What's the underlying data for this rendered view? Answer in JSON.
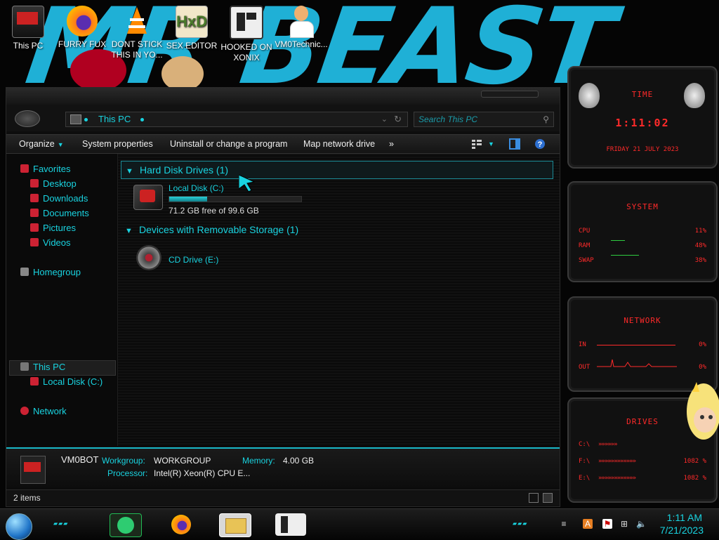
{
  "desktop": {
    "icons": [
      {
        "label": "This PC",
        "icon": "this-pc-icon"
      },
      {
        "label": "FURRY FUX",
        "icon": "firefox-icon"
      },
      {
        "label": "DONT STICK THIS IN YO...",
        "icon": "vlc-icon"
      },
      {
        "label": "SEX EDITOR",
        "icon": "hex-editor-icon"
      },
      {
        "label": "HOOKED ON XONIX",
        "icon": "game-icon"
      },
      {
        "label": "VM0Technic...",
        "icon": "user-doctor-icon"
      }
    ],
    "wallpaper_text": "MR BEAST"
  },
  "explorer": {
    "address_path": "This PC",
    "search_placeholder": "Search This PC",
    "toolbar": {
      "organize": "Organize",
      "system_properties": "System properties",
      "uninstall": "Uninstall or change a program",
      "map_drive": "Map network drive",
      "more": "»"
    },
    "nav": {
      "favorites": "Favorites",
      "desktop": "Desktop",
      "downloads": "Downloads",
      "documents": "Documents",
      "pictures": "Pictures",
      "videos": "Videos",
      "homegroup": "Homegroup",
      "this_pc": "This PC",
      "local_disk": "Local Disk (C:)",
      "network": "Network"
    },
    "groups": {
      "hdd_header": "Hard Disk Drives (1)",
      "removable_header": "Devices with Removable Storage (1)"
    },
    "drives": {
      "c_name": "Local Disk (C:)",
      "c_free": "71.2 GB free of 99.6 GB",
      "c_used_fraction": 0.285,
      "e_name": "CD Drive (E:)"
    },
    "details": {
      "computer_name": "VM0BOT",
      "workgroup_label": "Workgroup:",
      "workgroup_value": "WORKGROUP",
      "memory_label": "Memory:",
      "memory_value": "4.00 GB",
      "processor_label": "Processor:",
      "processor_value": "Intel(R) Xeon(R) CPU E..."
    },
    "status": "2 items"
  },
  "gadgets": {
    "time": {
      "title": "TIME",
      "clock": "1:11:02",
      "date": "FRIDAY 21 JULY 2023"
    },
    "system": {
      "title": "SYSTEM",
      "rows": [
        {
          "label": "CPU",
          "value": "11%"
        },
        {
          "label": "RAM",
          "value": "48%"
        },
        {
          "label": "SWAP",
          "value": "38%"
        }
      ]
    },
    "network": {
      "title": "NETWORK",
      "rows": [
        {
          "label": "IN",
          "value": "0%"
        },
        {
          "label": "OUT",
          "value": "0%"
        }
      ]
    },
    "drives": {
      "title": "DRIVES",
      "rows": [
        {
          "label": "C:\\",
          "value": ""
        },
        {
          "label": "F:\\",
          "value": "1082 %"
        },
        {
          "label": "E:\\",
          "value": "1082 %"
        }
      ]
    }
  },
  "taskbar": {
    "time": "1:11 AM",
    "date": "7/21/2023"
  },
  "colors": {
    "accent": "#19d3e0",
    "gadget_red": "#ff2a2a"
  }
}
